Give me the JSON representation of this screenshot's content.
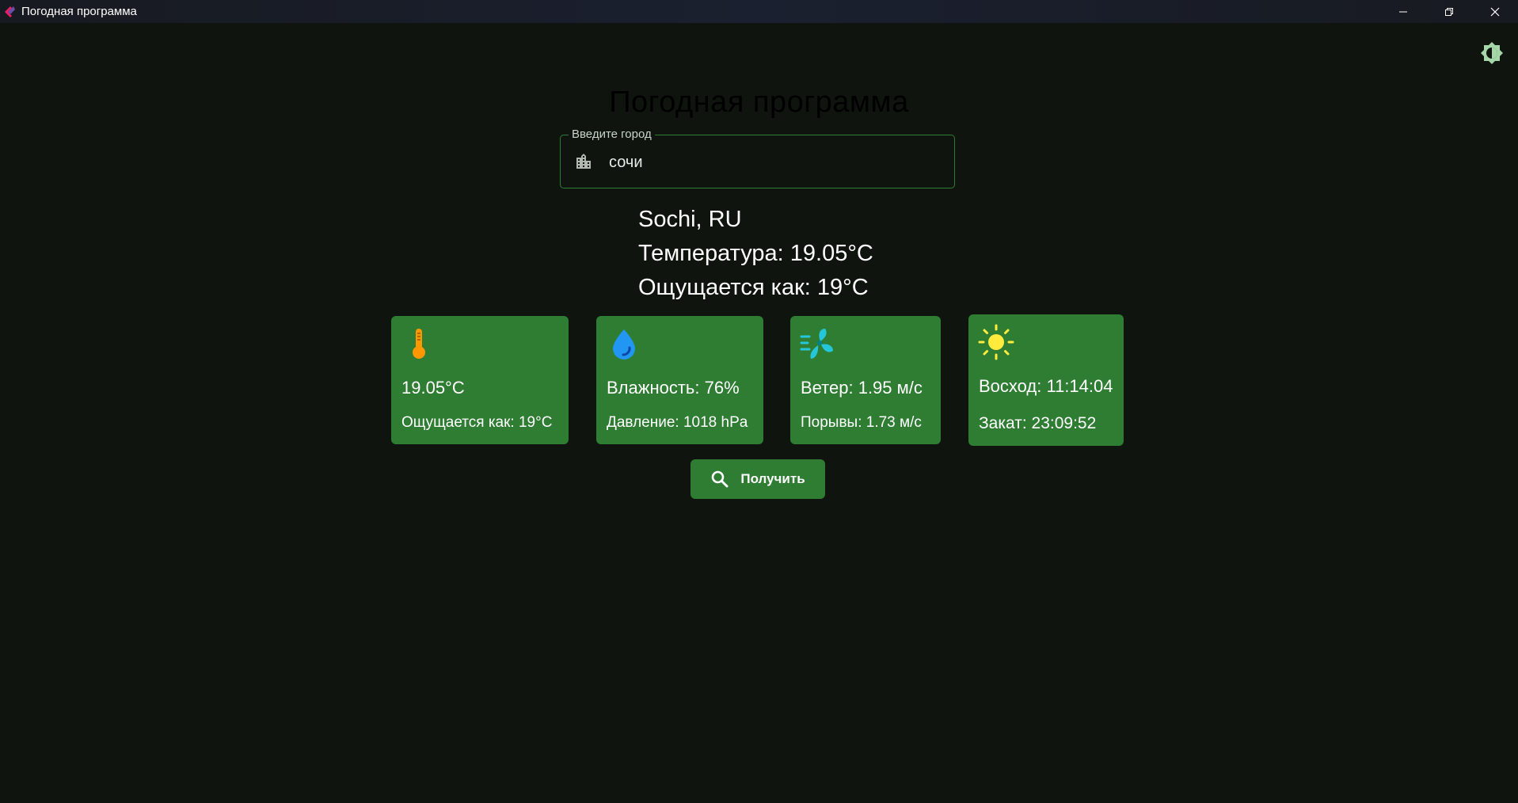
{
  "window": {
    "title": "Погодная программа",
    "icons": {
      "app": "app-logo-icon",
      "minimize": "minimize-icon",
      "restore": "restore-icon",
      "close": "close-icon"
    }
  },
  "theme_toggle": {
    "icon": "brightness-icon",
    "color": "#a5d6a7"
  },
  "app_title": "Погодная программа",
  "city_field": {
    "label": "Введите город",
    "value": "сочи",
    "icon": "location-city-icon"
  },
  "summary": {
    "location": "Sochi, RU",
    "temperature": "Температура: 19.05°C",
    "feels_like": "Ощущается как: 19°C"
  },
  "cards": {
    "temperature": {
      "icon": "thermometer-icon",
      "main": "19.05°C",
      "sub": "Ощущается как: 19°C",
      "icon_color": "#ff9800"
    },
    "humidity": {
      "icon": "water-drop-icon",
      "main": "Влажность: 76%",
      "sub": "Давление: 1018 hPa",
      "icon_color": "#2196f3"
    },
    "wind": {
      "icon": "wind-icon",
      "main": "Ветер: 1.95 м/с",
      "sub": "Порывы: 1.73 м/с",
      "icon_color": "#26c6da"
    },
    "sun": {
      "icon": "sun-icon",
      "main": "Восход: 11:14:04",
      "sub": "Закат: 23:09:52",
      "icon_color": "#ffeb3b"
    }
  },
  "fetch_button": {
    "label": "Получить",
    "icon": "search-icon"
  },
  "colors": {
    "background": "#0f140f",
    "accent": "#2e7d32",
    "text": "#ffffff"
  }
}
